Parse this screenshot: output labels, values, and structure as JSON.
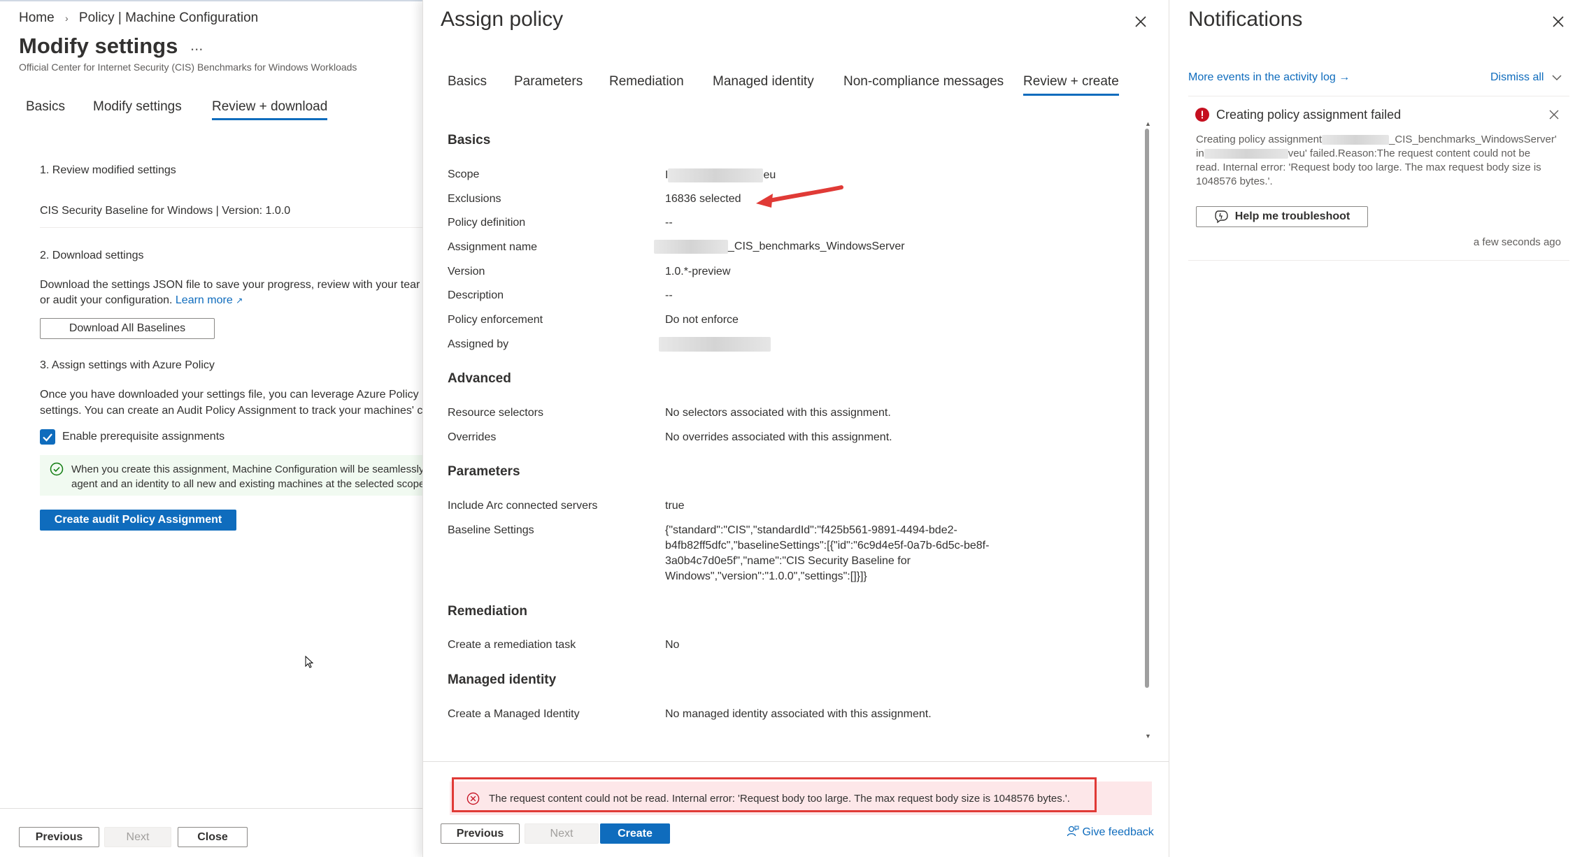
{
  "left": {
    "breadcrumb": [
      "Home",
      "Policy | Machine Configuration"
    ],
    "title": "Modify settings",
    "more": "...",
    "subtitle": "Official Center for Internet Security (CIS) Benchmarks for Windows Workloads",
    "tabs": [
      "Basics",
      "Modify settings",
      "Review + download"
    ],
    "step1": "1. Review modified settings",
    "baseline_line": "CIS Security Baseline for Windows | Version: 1.0.0",
    "step2": "2. Download settings",
    "download_text_1": "Download the settings JSON file to save your progress, review with your tear",
    "download_text_2": "or audit your configuration.",
    "learn_more": "Learn more",
    "download_button": "Download All Baselines",
    "step3": "3. Assign settings with Azure Policy",
    "assign_text_1": "Once you have downloaded your settings file, you can leverage Azure Policy",
    "assign_text_2": "settings. You can create an Audit Policy Assignment to track your machines' c",
    "checkbox_label": "Enable prerequisite assignments",
    "checkbox_checked": true,
    "info_text_1": "When you create this assignment, Machine Configuration will be seamlessly",
    "info_text_2": "agent and an identity to all new and existing machines at the selected scope",
    "create_audit_button": "Create audit Policy Assignment",
    "footer": {
      "previous": "Previous",
      "next": "Next",
      "close": "Close"
    }
  },
  "assign": {
    "title": "Assign policy",
    "tabs": [
      "Basics",
      "Parameters",
      "Remediation",
      "Managed identity",
      "Non-compliance messages",
      "Review + create"
    ],
    "basics": {
      "heading": "Basics",
      "scope_label": "Scope",
      "scope_value_start": "I",
      "scope_value_end": "eu",
      "exclusions_label": "Exclusions",
      "exclusions_value": "16836 selected",
      "policy_definition_label": "Policy definition",
      "policy_definition_value": "--",
      "assignment_name_label": "Assignment name",
      "assignment_name_value": "_CIS_benchmarks_WindowsServer",
      "version_label": "Version",
      "version_value": "1.0.*-preview",
      "description_label": "Description",
      "description_value": "--",
      "enforcement_label": "Policy enforcement",
      "enforcement_value": "Do not enforce",
      "assigned_by_label": "Assigned by"
    },
    "advanced": {
      "heading": "Advanced",
      "resource_selectors_label": "Resource selectors",
      "resource_selectors_value": "No selectors associated with this assignment.",
      "overrides_label": "Overrides",
      "overrides_value": "No overrides associated with this assignment."
    },
    "parameters": {
      "heading": "Parameters",
      "arc_label": "Include Arc connected servers",
      "arc_value": "true",
      "baseline_label": "Baseline Settings",
      "baseline_lines": [
        "{\"standard\":\"CIS\",\"standardId\":\"f425b561-9891-4494-bde2-",
        "b4fb82ff5dfc\",\"baselineSettings\":[{\"id\":\"6c9d4e5f-0a7b-6d5c-be8f-",
        "3a0b4c7d0e5f\",\"name\":\"CIS Security Baseline for",
        "Windows\",\"version\":\"1.0.0\",\"settings\":[]}]}"
      ]
    },
    "remediation": {
      "heading": "Remediation",
      "task_label": "Create a remediation task",
      "task_value": "No"
    },
    "managed_identity": {
      "heading": "Managed identity",
      "label": "Create a Managed Identity",
      "value": "No managed identity associated with this assignment."
    },
    "error_message": "The request content could not be read. Internal error: 'Request body too large. The max request body size is 1048576 bytes.'.",
    "footer": {
      "previous": "Previous",
      "next": "Next",
      "create": "Create",
      "feedback": "Give feedback"
    }
  },
  "notifications": {
    "title": "Notifications",
    "activity_link": "More events in the activity log →",
    "dismiss_all": "Dismiss all",
    "item": {
      "title": "Creating policy assignment failed",
      "body_p1": "Creating policy assignment",
      "body_p2": "_CIS_benchmarks_WindowsServer'",
      "body_p3": "in",
      "body_p4": "veu' failed.Reason:The request content could not be",
      "body_line3": "read. Internal error: 'Request body too large. The max request body size is",
      "body_line4": "1048576 bytes.'.",
      "button": "Help me troubleshoot",
      "time": "a few seconds ago"
    }
  },
  "colors": {
    "accent": "#0f6cbd",
    "error": "#c50f1f",
    "annotation": "#e03a36",
    "success": "#107c10"
  }
}
